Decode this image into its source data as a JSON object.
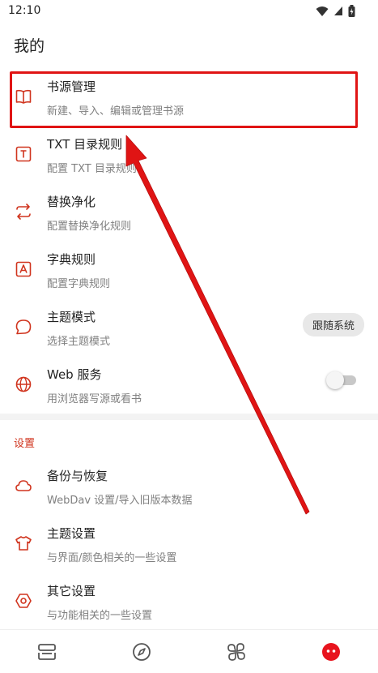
{
  "status_bar": {
    "time": "12:10"
  },
  "page": {
    "title": "我的"
  },
  "items": [
    {
      "title": "书源管理",
      "subtitle": "新建、导入、编辑或管理书源",
      "icon": "book-open-icon"
    },
    {
      "title": "TXT 目录规则",
      "subtitle": "配置 TXT 目录规则",
      "icon": "text-box-icon"
    },
    {
      "title": "替换净化",
      "subtitle": "配置替换净化规则",
      "icon": "swap-arrows-icon"
    },
    {
      "title": "字典规则",
      "subtitle": "配置字典规则",
      "icon": "dictionary-a-icon"
    },
    {
      "title": "主题模式",
      "subtitle": "选择主题模式",
      "icon": "chat-bubble-icon",
      "action_label": "跟随系统"
    },
    {
      "title": "Web 服务",
      "subtitle": "用浏览器写源或看书",
      "icon": "globe-icon",
      "toggle_on": false
    }
  ],
  "settings_section": {
    "label": "设置",
    "items": [
      {
        "title": "备份与恢复",
        "subtitle": "WebDav 设置/导入旧版本数据",
        "icon": "cloud-icon"
      },
      {
        "title": "主题设置",
        "subtitle": "与界面/颜色相关的一些设置",
        "icon": "tshirt-icon"
      },
      {
        "title": "其它设置",
        "subtitle": "与功能相关的一些设置",
        "icon": "gear-hexagon-icon"
      }
    ]
  },
  "bottom_nav": {
    "items": [
      {
        "icon": "bookshelf-icon"
      },
      {
        "icon": "compass-icon"
      },
      {
        "icon": "grid-clover-icon"
      },
      {
        "icon": "my-face-icon",
        "active": true
      }
    ]
  },
  "colors": {
    "accent": "#d0341e",
    "annotation": "#e01414"
  }
}
